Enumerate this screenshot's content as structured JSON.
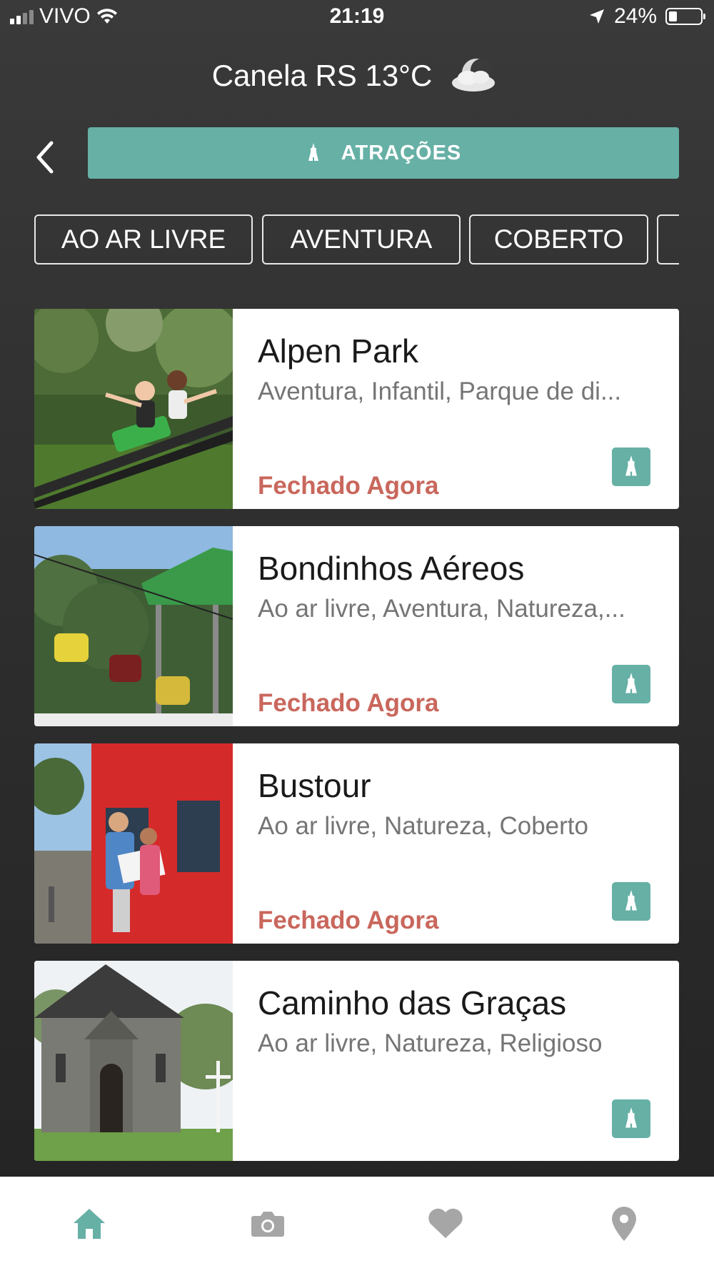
{
  "status_bar": {
    "carrier": "VIVO",
    "time": "21:19",
    "battery": "24%",
    "battery_level": 0.24
  },
  "weather": {
    "city_temp": "Canela RS 13°C",
    "icon": "cloud-moon-icon"
  },
  "header": {
    "title": "ATRAÇÕES",
    "icon": "tower-icon"
  },
  "filters": [
    "AO AR LIVRE",
    "AVENTURA",
    "COBERTO"
  ],
  "attractions": [
    {
      "name": "Alpen Park",
      "categories": "Aventura, Infantil, Parque de di...",
      "status": "Fechado Agora"
    },
    {
      "name": "Bondinhos Aéreos",
      "categories": "Ao ar livre, Aventura, Natureza,...",
      "status": "Fechado Agora"
    },
    {
      "name": "Bustour",
      "categories": "Ao ar livre, Natureza, Coberto",
      "status": "Fechado Agora"
    },
    {
      "name": "Caminho das Graças",
      "categories": "Ao ar livre, Natureza, Religioso",
      "status": ""
    }
  ],
  "tab_bar": {
    "items": [
      "home-icon",
      "camera-icon",
      "heart-icon",
      "map-pin-icon"
    ],
    "active_color": "#66b0a6",
    "inactive_color": "#a6a6a6"
  },
  "colors": {
    "accent": "#66b0a6",
    "status_closed": "#c9675c"
  }
}
